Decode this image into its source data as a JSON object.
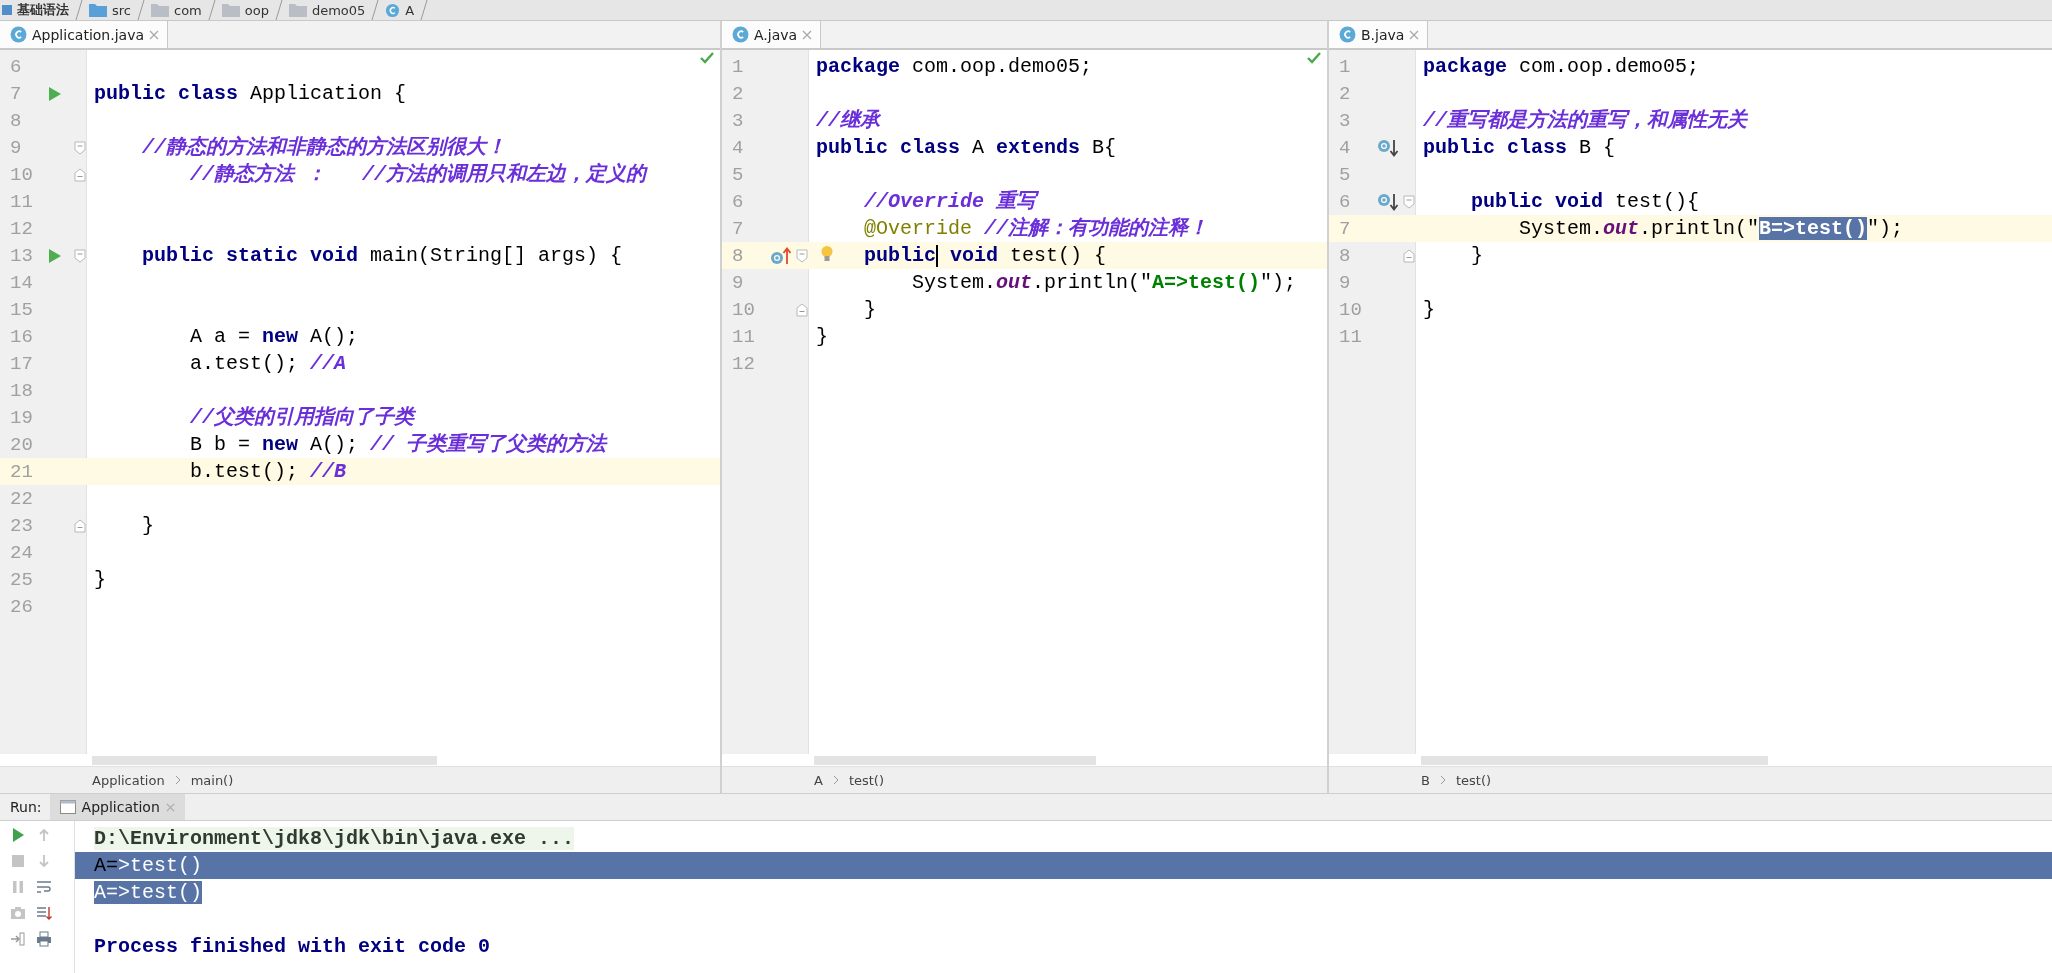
{
  "breadcrumb": [
    {
      "label": "基础语法",
      "kind": "module"
    },
    {
      "label": "src",
      "kind": "source"
    },
    {
      "label": "com",
      "kind": "package"
    },
    {
      "label": "oop",
      "kind": "package"
    },
    {
      "label": "demo05",
      "kind": "package"
    },
    {
      "label": "A",
      "kind": "class"
    }
  ],
  "editors": [
    {
      "tab": {
        "label": "Application.java",
        "selected": true
      },
      "analysis_ok": true,
      "footer": [
        "Application",
        "main()"
      ],
      "lines": [
        {
          "n": "6"
        },
        {
          "n": "7",
          "marks": [
            {
              "kind": "run"
            }
          ],
          "t": [
            {
              "kind": "kw",
              "s": "public class "
            },
            {
              "kind": "plain",
              "s": "Application {"
            }
          ]
        },
        {
          "n": "8"
        },
        {
          "n": "9",
          "fold_start": true,
          "t": [
            {
              "kind": "comment",
              "s": "    //静态的方法和非静态的方法区别很大！"
            }
          ]
        },
        {
          "n": "10",
          "fold_end": true,
          "t": [
            {
              "kind": "comment",
              "s": "        //静态方法 ：   //方法的调用只和左边，定义的"
            }
          ]
        },
        {
          "n": "11"
        },
        {
          "n": "12"
        },
        {
          "n": "13",
          "marks": [
            {
              "kind": "run"
            }
          ],
          "fold_start": true,
          "t": [
            {
              "kind": "kw",
              "s": "    public static void "
            },
            {
              "kind": "plain",
              "s": "main(String[] args) {"
            }
          ]
        },
        {
          "n": "14"
        },
        {
          "n": "15"
        },
        {
          "n": "16",
          "t": [
            {
              "kind": "plain",
              "s": "        A a = "
            },
            {
              "kind": "kw",
              "s": "new "
            },
            {
              "kind": "plain",
              "s": "A();"
            }
          ]
        },
        {
          "n": "17",
          "t": [
            {
              "kind": "plain",
              "s": "        a.test(); "
            },
            {
              "kind": "comment",
              "s": "//A"
            }
          ]
        },
        {
          "n": "18"
        },
        {
          "n": "19",
          "t": [
            {
              "kind": "comment",
              "s": "        //父类的引用指向了子类"
            }
          ]
        },
        {
          "n": "20",
          "t": [
            {
              "kind": "plain",
              "s": "        B b = "
            },
            {
              "kind": "kw",
              "s": "new "
            },
            {
              "kind": "plain",
              "s": "A(); "
            },
            {
              "kind": "comment",
              "s": "// 子类重写了父类的方法"
            }
          ]
        },
        {
          "n": "21",
          "current": true,
          "t": [
            {
              "kind": "plain",
              "s": "        b.test(); "
            },
            {
              "kind": "comment",
              "s": "//B"
            }
          ]
        },
        {
          "n": "22"
        },
        {
          "n": "23",
          "fold_end": true,
          "t": [
            {
              "kind": "plain",
              "s": "    }"
            }
          ]
        },
        {
          "n": "24"
        },
        {
          "n": "25",
          "t": [
            {
              "kind": "plain",
              "s": "}"
            }
          ]
        },
        {
          "n": "26"
        }
      ]
    },
    {
      "tab": {
        "label": "A.java",
        "selected": true
      },
      "analysis_ok": true,
      "footer": [
        "A",
        "test()"
      ],
      "lines": [
        {
          "n": "1",
          "t": [
            {
              "kind": "kw",
              "s": "package "
            },
            {
              "kind": "plain",
              "s": "com.oop.demo05;"
            }
          ]
        },
        {
          "n": "2"
        },
        {
          "n": "3",
          "t": [
            {
              "kind": "comment",
              "s": "//继承"
            }
          ]
        },
        {
          "n": "4",
          "t": [
            {
              "kind": "kw",
              "s": "public class "
            },
            {
              "kind": "plain",
              "s": "A "
            },
            {
              "kind": "kw",
              "s": "extends "
            },
            {
              "kind": "plain",
              "s": "B{"
            }
          ]
        },
        {
          "n": "5"
        },
        {
          "n": "6",
          "t": [
            {
              "kind": "comment",
              "s": "    //Override 重写"
            }
          ]
        },
        {
          "n": "7",
          "t": [
            {
              "kind": "annotation",
              "s": "    @Override "
            },
            {
              "kind": "comment",
              "s": "//注解：有功能的注释！"
            }
          ]
        },
        {
          "n": "8",
          "current": true,
          "marks": [
            {
              "kind": "overrides"
            }
          ],
          "bulb": true,
          "fold_start": true,
          "t": [
            {
              "kind": "kw",
              "s": "    public",
              "caret": true
            },
            {
              "kind": "kw",
              "s": " void "
            },
            {
              "kind": "plain",
              "s": "test() {"
            }
          ]
        },
        {
          "n": "9",
          "t": [
            {
              "kind": "plain",
              "s": "        System."
            },
            {
              "kind": "field",
              "s": "out"
            },
            {
              "kind": "plain",
              "s": ".println(\""
            },
            {
              "kind": "string",
              "s": "A=>test()"
            },
            {
              "kind": "plain",
              "s": "\");"
            }
          ]
        },
        {
          "n": "10",
          "fold_end": true,
          "t": [
            {
              "kind": "plain",
              "s": "    }"
            }
          ]
        },
        {
          "n": "11",
          "t": [
            {
              "kind": "plain",
              "s": "}"
            }
          ]
        },
        {
          "n": "12"
        }
      ]
    },
    {
      "tab": {
        "label": "B.java",
        "selected": true
      },
      "footer": [
        "B",
        "test()"
      ],
      "lines": [
        {
          "n": "1",
          "t": [
            {
              "kind": "kw",
              "s": "package "
            },
            {
              "kind": "plain",
              "s": "com.oop.demo05;"
            }
          ]
        },
        {
          "n": "2"
        },
        {
          "n": "3",
          "t": [
            {
              "kind": "comment",
              "s": "//重写都是方法的重写，和属性无关"
            }
          ]
        },
        {
          "n": "4",
          "marks": [
            {
              "kind": "overridden"
            }
          ],
          "t": [
            {
              "kind": "kw",
              "s": "public class "
            },
            {
              "kind": "plain",
              "s": "B {"
            }
          ]
        },
        {
          "n": "5"
        },
        {
          "n": "6",
          "marks": [
            {
              "kind": "overridden"
            }
          ],
          "fold_start": true,
          "t": [
            {
              "kind": "kw",
              "s": "    public void "
            },
            {
              "kind": "plain",
              "s": "test(){"
            }
          ]
        },
        {
          "n": "7",
          "current": true,
          "t": [
            {
              "kind": "plain",
              "s": "        System."
            },
            {
              "kind": "field",
              "s": "out"
            },
            {
              "kind": "plain",
              "s": ".println(\""
            },
            {
              "kind": "string",
              "s": "B=>test()",
              "selected": true
            },
            {
              "kind": "plain",
              "s": "\");"
            }
          ]
        },
        {
          "n": "8",
          "fold_end": true,
          "t": [
            {
              "kind": "plain",
              "s": "    }"
            }
          ]
        },
        {
          "n": "9"
        },
        {
          "n": "10",
          "t": [
            {
              "kind": "plain",
              "s": "}"
            }
          ]
        },
        {
          "n": "11"
        }
      ]
    }
  ],
  "run_panel": {
    "label": "Run:",
    "tab": {
      "label": "Application",
      "selected": true
    },
    "console": [
      {
        "kind": "command",
        "segs": [
          {
            "s": "D:\\Environment\\jdk8\\jdk\\bin\\java.exe ...",
            "selected": false
          }
        ]
      },
      {
        "kind": "output",
        "selected_eol": true,
        "segs": [
          {
            "s": "A=",
            "selected": false
          },
          {
            "s": ">test()",
            "selected": true
          }
        ]
      },
      {
        "kind": "output",
        "selected_eol": false,
        "segs": [
          {
            "s": "A=>test()",
            "selected": true
          }
        ]
      },
      {
        "kind": "exit",
        "segs": [
          {
            "s": "Process finished with exit code 0",
            "selected": false
          }
        ]
      }
    ]
  }
}
